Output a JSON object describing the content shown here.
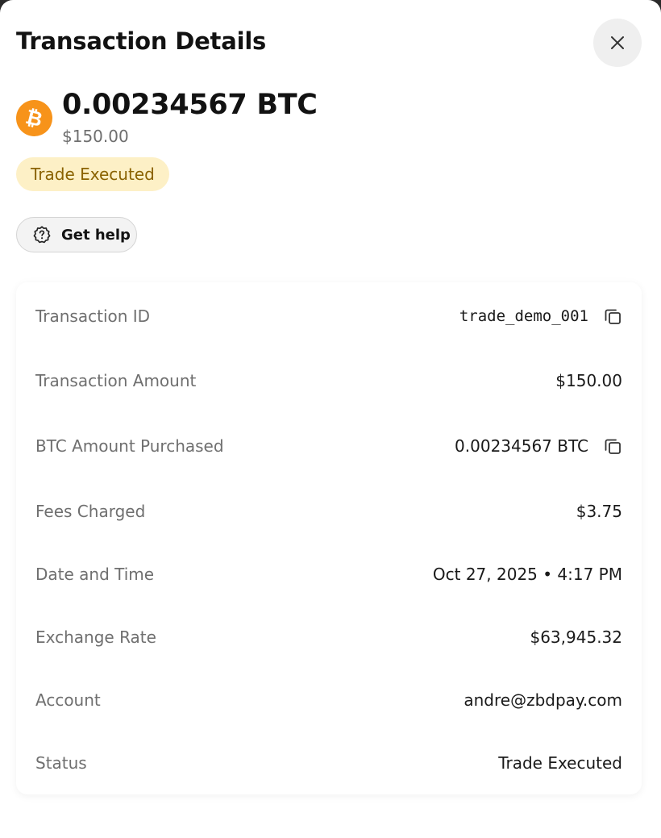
{
  "header": {
    "title": "Transaction Details"
  },
  "summary": {
    "currency_symbol": "₿",
    "btc_amount": "0.00234567 BTC",
    "fiat_amount": "$150.00",
    "status": "Trade Executed"
  },
  "help": {
    "label": "Get help"
  },
  "details": [
    {
      "key": "Transaction ID",
      "value": "trade_demo_001"
    },
    {
      "key": "Transaction Amount",
      "value": "$150.00"
    },
    {
      "key": "BTC Amount Purchased",
      "value": "0.00234567 BTC"
    },
    {
      "key": "Fees Charged",
      "value": "$3.75"
    },
    {
      "key": "Date and Time",
      "value": "Oct 27, 2025 • 4:17 PM"
    },
    {
      "key": "Exchange Rate",
      "value": "$63,945.32"
    },
    {
      "key": "Account",
      "value": "andre@zbdpay.com"
    },
    {
      "key": "Status",
      "value": "Trade Executed"
    }
  ],
  "icons": {
    "close": "close-icon",
    "bitcoin": "bitcoin-icon",
    "help": "help-badge-icon",
    "copy": "copy-icon"
  },
  "colors": {
    "bitcoin": "#f7931a",
    "status_bg": "#fdf0c6",
    "status_text": "#8a6200"
  }
}
